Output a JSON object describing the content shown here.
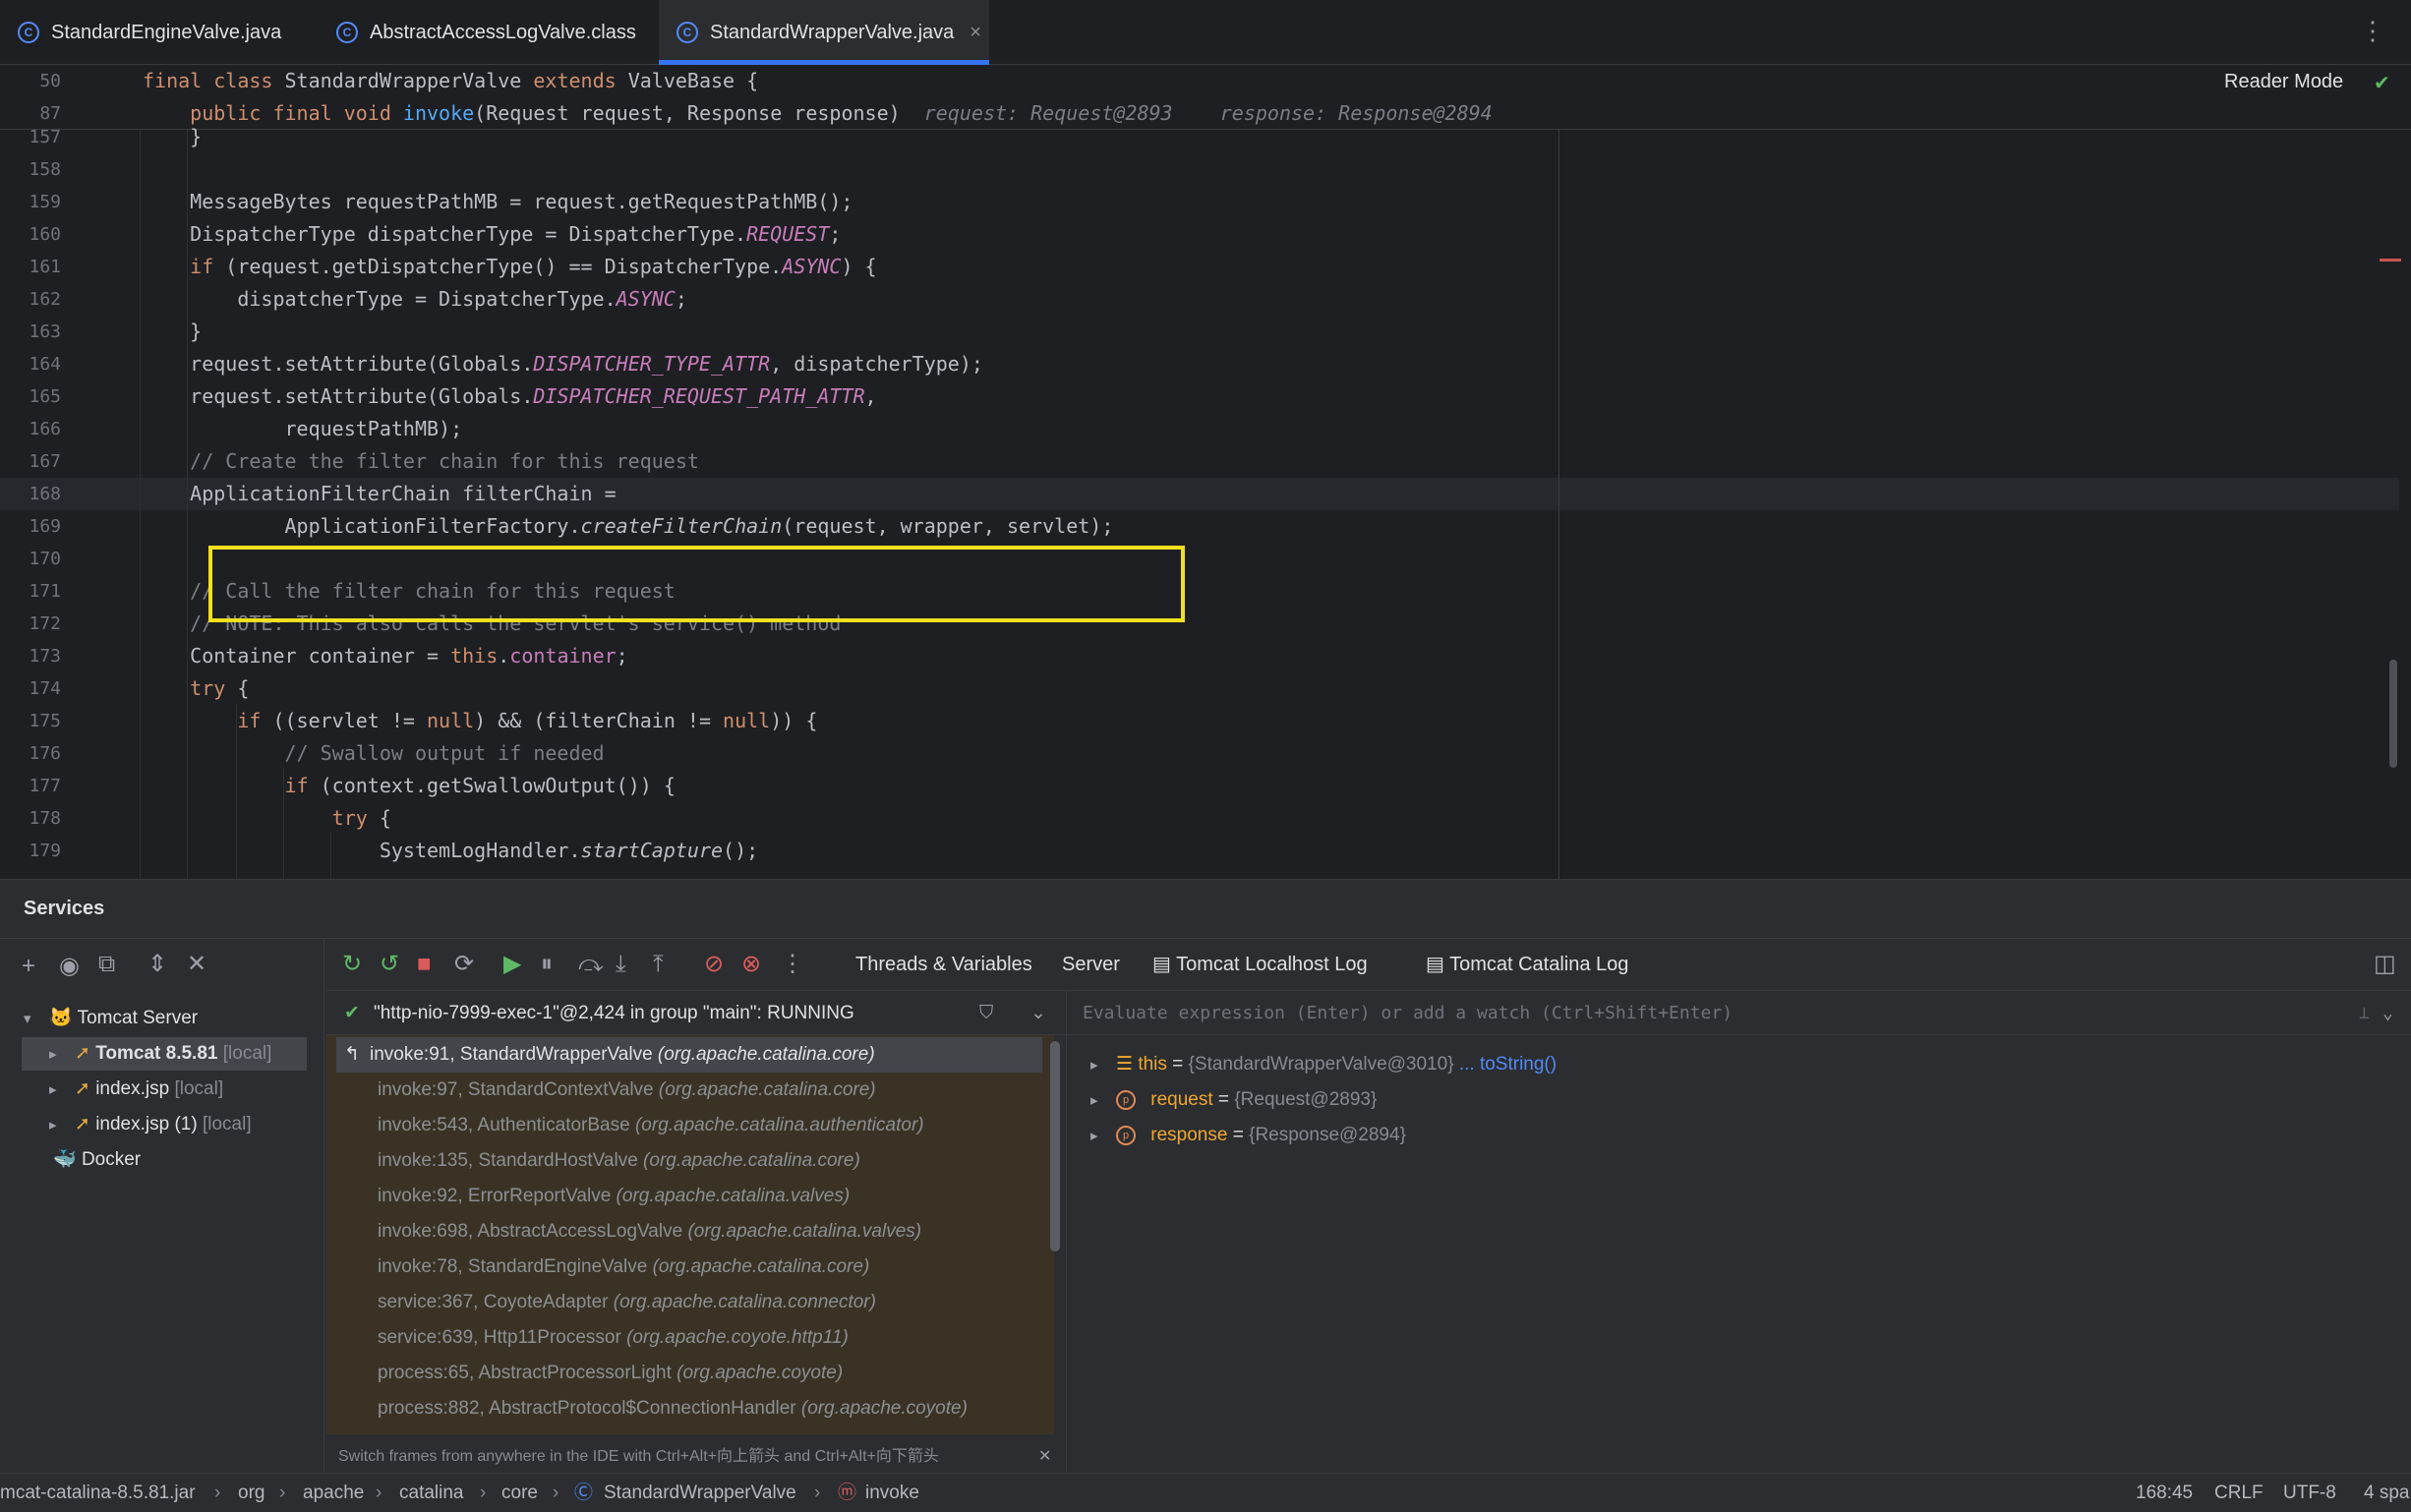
{
  "tabs": [
    {
      "label": "StandardEngineValve.java",
      "active": false
    },
    {
      "label": "AbstractAccessLogValve.class",
      "active": false
    },
    {
      "label": "StandardWrapperValve.java",
      "active": true
    }
  ],
  "tab_close_glyph": "×",
  "tab_menu_glyph": "⋮",
  "editor": {
    "reader_mode": "Reader Mode",
    "sticky": [
      {
        "num": "50",
        "parts": [
          [
            "kw",
            "final class "
          ],
          [
            "",
            "StandardWrapperValve "
          ],
          [
            "kw",
            "extends "
          ],
          [
            "",
            "ValveBase {"
          ]
        ]
      },
      {
        "num": "87",
        "parts": [
          [
            "",
            "    "
          ],
          [
            "kw",
            "public final void "
          ],
          [
            "fn",
            "invoke"
          ],
          [
            "",
            "(Request request, Response response)"
          ],
          [
            "hint",
            "  request: Request@2893    response: Response@2894"
          ]
        ]
      }
    ],
    "lines": [
      {
        "num": "157",
        "parts": [
          [
            "",
            "    }"
          ]
        ]
      },
      {
        "num": "158",
        "parts": []
      },
      {
        "num": "159",
        "parts": [
          [
            "",
            "    MessageBytes requestPathMB = request.getRequestPathMB();"
          ]
        ]
      },
      {
        "num": "160",
        "parts": [
          [
            "",
            "    DispatcherType dispatcherType = DispatcherType."
          ],
          [
            "st",
            "REQUEST"
          ],
          [
            "",
            ";"
          ]
        ]
      },
      {
        "num": "161",
        "parts": [
          [
            "",
            "    "
          ],
          [
            "kw",
            "if "
          ],
          [
            "",
            "(request.getDispatcherType() == DispatcherType."
          ],
          [
            "st",
            "ASYNC"
          ],
          [
            "",
            ") {"
          ]
        ]
      },
      {
        "num": "162",
        "parts": [
          [
            "",
            "        dispatcherType = DispatcherType."
          ],
          [
            "st",
            "ASYNC"
          ],
          [
            "",
            ";"
          ]
        ]
      },
      {
        "num": "163",
        "parts": [
          [
            "",
            "    }"
          ]
        ]
      },
      {
        "num": "164",
        "parts": [
          [
            "",
            "    request.setAttribute(Globals."
          ],
          [
            "st",
            "DISPATCHER_TYPE_ATTR"
          ],
          [
            "",
            ", dispatcherType);"
          ]
        ]
      },
      {
        "num": "165",
        "parts": [
          [
            "",
            "    request.setAttribute(Globals."
          ],
          [
            "st",
            "DISPATCHER_REQUEST_PATH_ATTR"
          ],
          [
            "",
            ","
          ]
        ]
      },
      {
        "num": "166",
        "parts": [
          [
            "",
            "            requestPathMB);"
          ]
        ]
      },
      {
        "num": "167",
        "parts": [
          [
            "cm",
            "    // Create the filter chain for this request"
          ]
        ]
      },
      {
        "num": "168",
        "parts": [
          [
            "",
            "    ApplicationFilterChain filterChain ="
          ]
        ],
        "current": true
      },
      {
        "num": "169",
        "parts": [
          [
            "",
            "            ApplicationFilterFactory."
          ],
          [
            "it",
            "createFilterChain"
          ],
          [
            "",
            "(request, wrapper, servlet);"
          ]
        ]
      },
      {
        "num": "170",
        "parts": []
      },
      {
        "num": "171",
        "parts": [
          [
            "cm",
            "    // Call the filter chain for this request"
          ]
        ]
      },
      {
        "num": "172",
        "parts": [
          [
            "cm",
            "    // NOTE: This also calls the servlet's service() method"
          ]
        ]
      },
      {
        "num": "173",
        "parts": [
          [
            "",
            "    Container container = "
          ],
          [
            "kw",
            "this"
          ],
          [
            "",
            "."
          ],
          [
            "fi",
            "container"
          ],
          [
            "",
            ";"
          ]
        ]
      },
      {
        "num": "174",
        "parts": [
          [
            "",
            "    "
          ],
          [
            "kw",
            "try "
          ],
          [
            "",
            "{"
          ]
        ]
      },
      {
        "num": "175",
        "parts": [
          [
            "",
            "        "
          ],
          [
            "kw",
            "if "
          ],
          [
            "",
            "((servlet != "
          ],
          [
            "kw",
            "null"
          ],
          [
            "",
            ") && (filterChain != "
          ],
          [
            "kw",
            "null"
          ],
          [
            "",
            ")) {"
          ]
        ]
      },
      {
        "num": "176",
        "parts": [
          [
            "cm",
            "            // Swallow output if needed"
          ]
        ]
      },
      {
        "num": "177",
        "parts": [
          [
            "",
            "            "
          ],
          [
            "kw",
            "if "
          ],
          [
            "",
            "(context.getSwallowOutput()) {"
          ]
        ]
      },
      {
        "num": "178",
        "parts": [
          [
            "",
            "                "
          ],
          [
            "kw",
            "try "
          ],
          [
            "",
            "{"
          ]
        ]
      },
      {
        "num": "179",
        "parts": [
          [
            "",
            "                    SystemLogHandler."
          ],
          [
            "it",
            "startCapture"
          ],
          [
            "",
            "();"
          ]
        ]
      }
    ]
  },
  "services": {
    "title": "Services",
    "tree": [
      {
        "label": "Tomcat Server",
        "suffix": "",
        "bold": false
      },
      {
        "label": "Tomcat 8.5.81",
        "suffix": "[local]",
        "bold": true
      },
      {
        "label": "index.jsp",
        "suffix": "[local]",
        "bold": false
      },
      {
        "label": "index.jsp (1)",
        "suffix": "[local]",
        "bold": false
      },
      {
        "label": "Docker",
        "suffix": "",
        "bold": false
      }
    ],
    "debug_tabs": [
      "Threads & Variables",
      "Server",
      "Tomcat Localhost Log",
      "Tomcat Catalina Log"
    ],
    "thread": "\"http-nio-7999-exec-1\"@2,424 in group \"main\": RUNNING",
    "frames": [
      {
        "m": "invoke:91, StandardWrapperValve ",
        "p": "(org.apache.catalina.core)"
      },
      {
        "m": "invoke:97, StandardContextValve ",
        "p": "(org.apache.catalina.core)"
      },
      {
        "m": "invoke:543, AuthenticatorBase ",
        "p": "(org.apache.catalina.authenticator)"
      },
      {
        "m": "invoke:135, StandardHostValve ",
        "p": "(org.apache.catalina.core)"
      },
      {
        "m": "invoke:92, ErrorReportValve ",
        "p": "(org.apache.catalina.valves)"
      },
      {
        "m": "invoke:698, AbstractAccessLogValve ",
        "p": "(org.apache.catalina.valves)"
      },
      {
        "m": "invoke:78, StandardEngineValve ",
        "p": "(org.apache.catalina.core)"
      },
      {
        "m": "service:367, CoyoteAdapter ",
        "p": "(org.apache.catalina.connector)"
      },
      {
        "m": "service:639, Http11Processor ",
        "p": "(org.apache.coyote.http11)"
      },
      {
        "m": "process:65, AbstractProcessorLight ",
        "p": "(org.apache.coyote)"
      },
      {
        "m": "process:882, AbstractProtocol$ConnectionHandler ",
        "p": "(org.apache.coyote)"
      }
    ],
    "frames_hint": "Switch frames from anywhere in the IDE with Ctrl+Alt+向上箭头 and Ctrl+Alt+向下箭头",
    "eval_placeholder": "Evaluate expression (Enter) or add a watch (Ctrl+Shift+Enter)",
    "variables": [
      {
        "name": "this",
        "eq": " = ",
        "value": "{StandardWrapperValve@3010}",
        "link": " ... toString()"
      },
      {
        "name": "request",
        "eq": " = ",
        "value": "{Request@2893}",
        "link": ""
      },
      {
        "name": "response",
        "eq": " = ",
        "value": "{Response@2894}",
        "link": ""
      }
    ]
  },
  "statusbar": {
    "crumbs": [
      "mcat-catalina-8.5.81.jar",
      "org",
      "apache",
      "catalina",
      "core",
      "StandardWrapperValve",
      "invoke"
    ],
    "position": "168:45",
    "line_sep": "CRLF",
    "encoding": "UTF-8",
    "indent": "4 spa"
  }
}
